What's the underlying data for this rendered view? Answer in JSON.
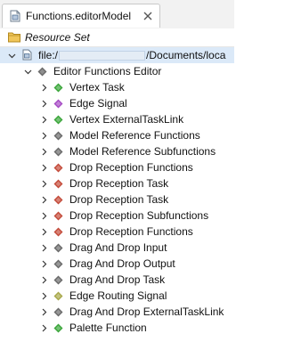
{
  "tab": {
    "title": "Functions.editorModel",
    "close_icon": "close-icon"
  },
  "resource_set": {
    "label": "Resource Set"
  },
  "tree": {
    "file_node": {
      "label_prefix": "file:/",
      "label_suffix": "/Documents/loca",
      "expanded": true
    },
    "root_node": {
      "label": "Editor Functions Editor",
      "expanded": true
    },
    "children": [
      {
        "label": "Vertex Task",
        "icon": "green-diamond-icon",
        "color": "#3aa63a"
      },
      {
        "label": "Edge Signal",
        "icon": "purple-diamond-icon",
        "color": "#a64bc4"
      },
      {
        "label": "Vertex ExternalTaskLink",
        "icon": "green-diamond-icon",
        "color": "#3aa63a"
      },
      {
        "label": "Model Reference Functions",
        "icon": "gray-diamond-icon",
        "color": "#6a6a6a"
      },
      {
        "label": "Model Reference Subfunctions",
        "icon": "gray-diamond-icon",
        "color": "#6a6a6a"
      },
      {
        "label": "Drop Reception Functions",
        "icon": "red-diamond-icon",
        "color": "#c44b3a"
      },
      {
        "label": "Drop Reception Task",
        "icon": "red-diamond-icon",
        "color": "#c44b3a"
      },
      {
        "label": "Drop Reception Task",
        "icon": "red-diamond-icon",
        "color": "#c44b3a"
      },
      {
        "label": "Drop Reception Subfunctions",
        "icon": "red-diamond-icon",
        "color": "#c44b3a"
      },
      {
        "label": "Drop Reception Functions",
        "icon": "red-diamond-icon",
        "color": "#c44b3a"
      },
      {
        "label": "Drag And Drop Input",
        "icon": "gray-diamond-icon",
        "color": "#6a6a6a"
      },
      {
        "label": "Drag And Drop Output",
        "icon": "gray-diamond-icon",
        "color": "#6a6a6a"
      },
      {
        "label": "Drag And Drop Task",
        "icon": "gray-diamond-icon",
        "color": "#6a6a6a"
      },
      {
        "label": "Edge Routing Signal",
        "icon": "olive-diamond-icon",
        "color": "#a8a84a"
      },
      {
        "label": "Drag And Drop ExternalTaskLink",
        "icon": "gray-diamond-icon",
        "color": "#6a6a6a"
      },
      {
        "label": "Palette Function",
        "icon": "green-diamond-icon",
        "color": "#3aa63a"
      }
    ]
  }
}
